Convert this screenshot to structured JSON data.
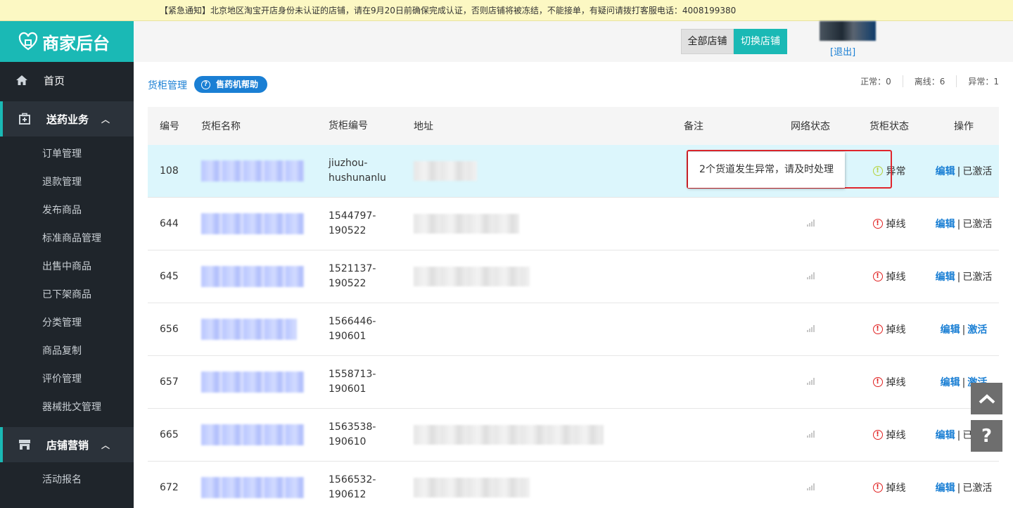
{
  "notice": "【紧急通知】北京地区淘宝开店身份未认证的店铺，请在9月20日前确保完成认证，否则店铺将被冻结，不能接单，有疑问请拨打客服电话：4008199380",
  "logo": {
    "text": "商家后台",
    "icon": "shop-heart-icon"
  },
  "sidebar": {
    "home": {
      "label": "首页",
      "icon": "home-icon"
    },
    "groups": [
      {
        "label": "送药业务",
        "icon": "medical-box-icon",
        "items": [
          "订单管理",
          "退款管理",
          "发布商品",
          "标准商品管理",
          "出售中商品",
          "已下架商品",
          "分类管理",
          "商品复制",
          "评价管理",
          "器械批文管理"
        ]
      },
      {
        "label": "店铺营销",
        "icon": "store-icon",
        "items": [
          "活动报名"
        ]
      }
    ]
  },
  "topbar": {
    "all_stores": "全部店铺",
    "switch_store": "切换店铺",
    "logout": "[退出]"
  },
  "breadcrumb": "货柜管理",
  "help_button": "售药机帮助",
  "stats": {
    "normal": "正常：0",
    "offline": "离线：6",
    "abnormal": "异常：1"
  },
  "table": {
    "headers": [
      "编号",
      "货柜名称",
      "货柜编号",
      "地址",
      "备注",
      "网络状态",
      "货柜状态",
      "操作"
    ],
    "rows": [
      {
        "id": "108",
        "code1": "jiuzhou-",
        "code2": "hushunanlu",
        "status": "异常",
        "status_type": "warn",
        "edit": "编辑",
        "activation": "已激活",
        "activation_link": false,
        "highlight": true
      },
      {
        "id": "644",
        "code1": "1544797-",
        "code2": "190522",
        "status": "掉线",
        "status_type": "error",
        "edit": "编辑",
        "activation": "已激活",
        "activation_link": false
      },
      {
        "id": "645",
        "code1": "1521137-",
        "code2": "190522",
        "status": "掉线",
        "status_type": "error",
        "edit": "编辑",
        "activation": "已激活",
        "activation_link": false
      },
      {
        "id": "656",
        "code1": "1566446-",
        "code2": "190601",
        "status": "掉线",
        "status_type": "error",
        "edit": "编辑",
        "activation": "激活",
        "activation_link": true
      },
      {
        "id": "657",
        "code1": "1558713-",
        "code2": "190601",
        "status": "掉线",
        "status_type": "error",
        "edit": "编辑",
        "activation": "激活",
        "activation_link": true
      },
      {
        "id": "665",
        "code1": "1563538-",
        "code2": "190610",
        "status": "掉线",
        "status_type": "error",
        "edit": "编辑",
        "activation": "已激活",
        "activation_link": false
      },
      {
        "id": "672",
        "code1": "1566532-",
        "code2": "190612",
        "status": "掉线",
        "status_type": "error",
        "edit": "编辑",
        "activation": "已激活",
        "activation_link": false
      }
    ]
  },
  "tooltip": "2个货道发生异常，请及时处理",
  "floating": {
    "up_icon": "chevron-up-icon",
    "help_icon": "question-icon"
  },
  "colors": {
    "accent": "#1ab9b5",
    "link": "#1a7fd4",
    "sidebar_bg": "#1f252b",
    "error": "#e02020",
    "warn": "#b5d23a",
    "highlight_row": "#dcf6fc"
  }
}
